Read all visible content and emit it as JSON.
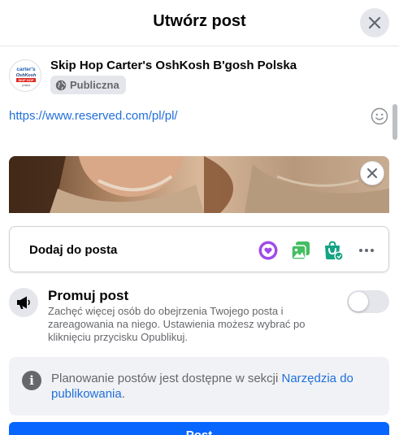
{
  "header": {
    "title": "Utwórz post"
  },
  "author": {
    "name": "Skip Hop Carter's OshKosh B'gosh Polska",
    "privacy": "Publiczna",
    "logo_text": [
      "carter's",
      "OshKosh",
      "SKIP HOP",
      "polska"
    ]
  },
  "composer": {
    "text": "https://www.reserved.com/pl/pl/"
  },
  "add_to_post": {
    "label": "Dodaj do posta",
    "icons": [
      "tag-heart-icon",
      "photo-video-icon",
      "shopping-bag-icon",
      "more-icon"
    ]
  },
  "promote": {
    "title": "Promuj post",
    "description": "Zachęć więcej osób do obejrzenia Twojego posta i zareagowania na niego. Ustawienia możesz wybrać po kliknięciu przycisku Opublikuj.",
    "enabled": false
  },
  "scheduling_info": {
    "text": "Planowanie postów jest dostępne w sekcji ",
    "link": "Narzędzia do publikowania",
    "suffix": "."
  },
  "footer": {
    "post_button": "Post"
  },
  "colors": {
    "accent": "#0866ff",
    "link": "#216fdb",
    "secondary_text": "#65676b",
    "add_heart": "#a04be8",
    "add_photo": "#45bd62",
    "add_shop": "#14a384"
  }
}
